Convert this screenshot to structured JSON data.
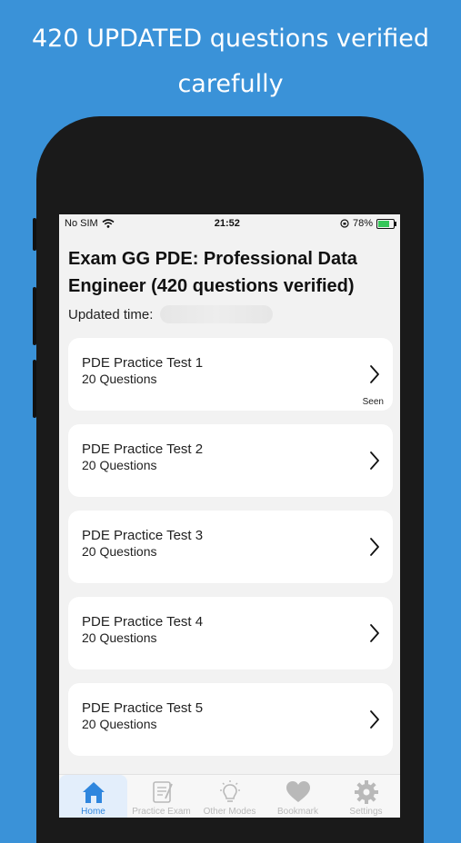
{
  "promo": {
    "line1": "420 UPDATED questions verified",
    "line2": "carefully"
  },
  "status": {
    "carrier": "No SIM",
    "time": "21:52",
    "battery": "78%",
    "battery_level": 0.78
  },
  "header": {
    "title_line1": "Exam GG PDE: Professional Data",
    "title_line2": "Engineer (420 questions verified)",
    "updated_label": "Updated time:"
  },
  "tests": [
    {
      "title": "PDE Practice Test 1",
      "count": "20 Questions",
      "badge": "Seen"
    },
    {
      "title": "PDE Practice Test 2",
      "count": "20 Questions",
      "badge": ""
    },
    {
      "title": "PDE Practice Test 3",
      "count": "20 Questions",
      "badge": ""
    },
    {
      "title": "PDE Practice Test 4",
      "count": "20 Questions",
      "badge": ""
    },
    {
      "title": "PDE Practice Test 5",
      "count": "20 Questions",
      "badge": ""
    }
  ],
  "tabs": [
    {
      "label": "Home",
      "icon": "home-icon",
      "active": true
    },
    {
      "label": "Practice Exam",
      "icon": "exam-icon",
      "active": false
    },
    {
      "label": "Other Modes",
      "icon": "lightbulb-icon",
      "active": false
    },
    {
      "label": "Bookmark",
      "icon": "heart-icon",
      "active": false
    },
    {
      "label": "Settings",
      "icon": "gear-icon",
      "active": false
    }
  ],
  "colors": {
    "background": "#3a92d8",
    "accent": "#2f86de",
    "inactive": "#b9b9b9"
  }
}
